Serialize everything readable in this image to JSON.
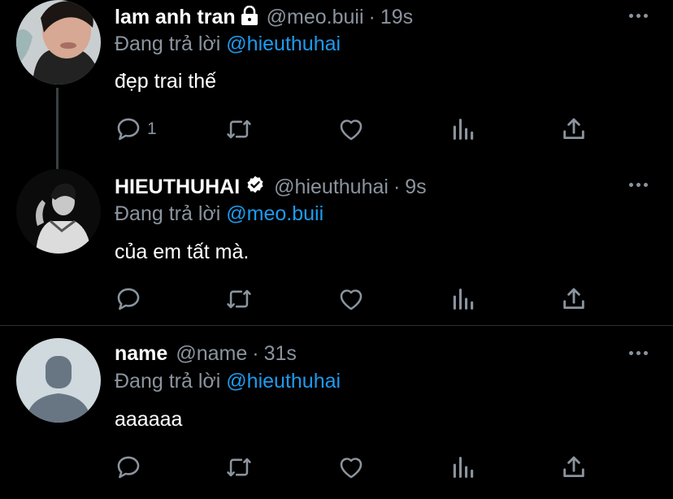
{
  "colors": {
    "background": "#000000",
    "muted": "#8b949e",
    "mention": "#1d9bf0",
    "divider": "#2f3336"
  },
  "tweets": [
    {
      "display_name": "lam anh tran",
      "badge_icon": "lock-icon",
      "handle": "@meo.buii",
      "separator": "·",
      "time": "19s",
      "replying_prefix": "Đang trả lời",
      "replying_to": "@hieuthuhai",
      "text": "đẹp trai thế",
      "reply_count": "1"
    },
    {
      "display_name": "HIEUTHUHAI",
      "badge_icon": "verified-icon",
      "handle": "@hieuthuhai",
      "separator": "·",
      "time": "9s",
      "replying_prefix": "Đang trả lời",
      "replying_to": "@meo.buii",
      "text": "của em tất mà.",
      "reply_count": ""
    },
    {
      "display_name": "name",
      "badge_icon": "",
      "handle": "@name",
      "separator": "·",
      "time": "31s",
      "replying_prefix": "Đang trả lời",
      "replying_to": "@hieuthuhai",
      "text": "aaaaaa",
      "reply_count": ""
    }
  ],
  "action_icons": [
    "reply-icon",
    "retweet-icon",
    "like-icon",
    "analytics-icon",
    "share-icon"
  ]
}
